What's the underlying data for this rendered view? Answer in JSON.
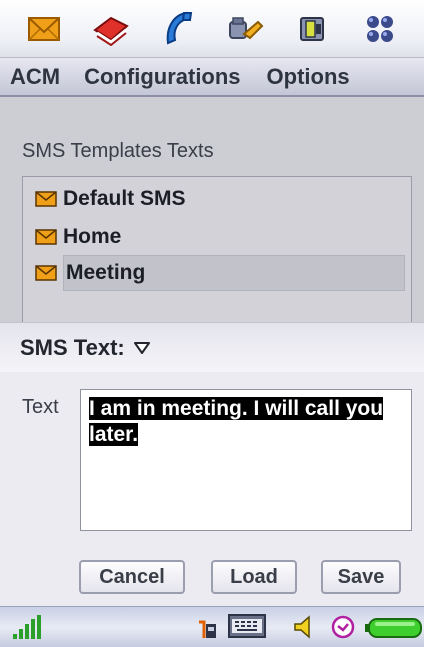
{
  "toolbar": {
    "icons": [
      "envelope-icon",
      "book-icon",
      "phone-icon",
      "tools-icon",
      "card-reader-icon",
      "apps-grid-icon"
    ]
  },
  "menu": {
    "items": [
      {
        "label": "ACM"
      },
      {
        "label": "Configurations"
      },
      {
        "label": "Options"
      }
    ]
  },
  "templates": {
    "title": "SMS Templates Texts",
    "items": [
      {
        "label": "Default SMS",
        "selected": false
      },
      {
        "label": "Home",
        "selected": false
      },
      {
        "label": "Meeting",
        "selected": true
      }
    ]
  },
  "sms": {
    "header": "SMS Text:",
    "text_label": "Text",
    "text_value": "I am in meeting. I will call you later."
  },
  "buttons": {
    "cancel": "Cancel",
    "load": "Load",
    "save": "Save"
  },
  "status_bar": {
    "icons": [
      "signal-strength-icon",
      "sim-card-icon",
      "keyboard-icon",
      "speaker-icon",
      "clock-icon",
      "battery-icon"
    ]
  },
  "colors": {
    "envelope": "#f0a018",
    "selection_bg": "#000000",
    "battery": "#3ecf2e"
  }
}
